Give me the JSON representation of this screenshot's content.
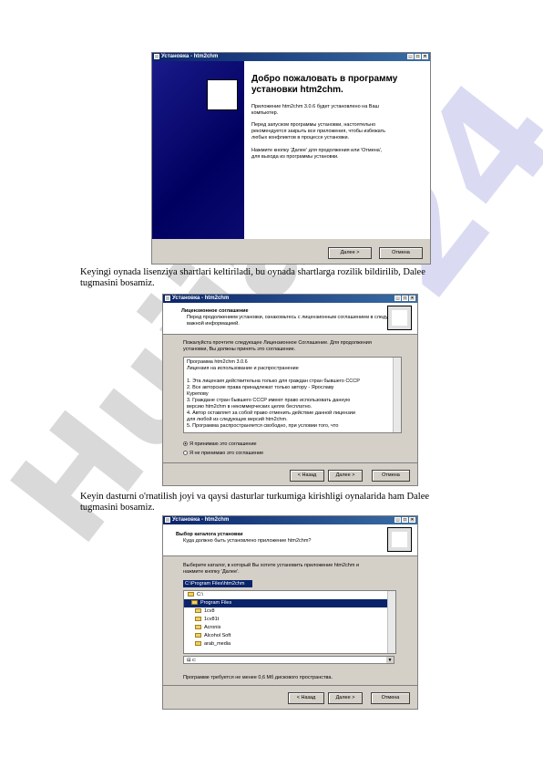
{
  "w1": {
    "title": "Установка - htm2chm",
    "heading1": "Добро пожаловать в программу",
    "heading2": "установки htm2chm.",
    "p1a": "Приложение htm2chm 3.0.6 будет установлено на Ваш",
    "p1b": "компьютер.",
    "p2a": "Перед запуском программы установки, настоятельно",
    "p2b": "рекомендуется закрыть все приложения, чтобы избежать",
    "p2c": "любых конфликтов в процессе установки.",
    "p3a": "Нажмите кнопку 'Далее' для продолжения или 'Отмена',",
    "p3b": "для выхода из программы установки.",
    "next": "Далее >",
    "cancel": "Отмена"
  },
  "para1": {
    "l1": "Keyingi oynada lisenziya shartlari keltiriladi,  bu oynada shartlarga rozilik bildirilib,  Dalee",
    "l2": "tugmasini bosamiz."
  },
  "w2": {
    "title": "Установка - htm2chm",
    "hdr_title": "Лицензионное соглашение",
    "hdr_sub1": "Перед продолжением установки, ознакомьтесь с лицензионным соглашением в следующей",
    "hdr_sub2": "важной информацией.",
    "intro1": "Пожалуйста прочтите следующее Лицензионное Соглашение. Для продолжения",
    "intro2": "установки, Вы должны принять это соглашение.",
    "license": [
      "Программа htm2chm 3.0.6",
      "Лицензия на использование и распространение",
      "",
      "1. Эта лицензия действительна только для граждан стран бывшего СССР",
      "2. Все авторские права принадлежат только автору - Ярославу",
      "Курепову",
      "3. Граждане стран бывшего СССР имеют право использовать данную",
      "версию htm2chm в некоммерческих целях бесплатно.",
      "4. Автор оставляет за собой право отменить действие данной лицензии",
      "для любой из следующих версий htm2chm.",
      "5. Программа распространяется свободно, при условии того, что"
    ],
    "accept": "Я принимаю это соглашение",
    "decline": "Я не принимаю это соглашение",
    "back": "< Назад",
    "next": "Далее >",
    "cancel": "Отмена"
  },
  "para2": {
    "l1": "Keyin  dasturni  o'rnatilish  joyi  va  qaysi  dasturlar  turkumiga  kirishligi  oynalarida  ham  Dalee",
    "l2": "tugmasini bosamiz."
  },
  "w3": {
    "title": "Установка - htm2chm",
    "hdr_title": "Выбор каталога установки",
    "hdr_sub": "Куда должно быть установлено приложение htm2chm?",
    "prompt1": "Выберите каталог, в который Вы хотите установить приложение htm2chm и",
    "prompt2": "нажмите кнопку 'Далее'.",
    "path": "C:\\Program Files\\htm2chm",
    "folders": [
      "C:\\",
      "Program Files",
      "1cv8",
      "1cv81t",
      "Acronis",
      "Alcohol Soft",
      "arab_media"
    ],
    "drive": "c:",
    "space": "Программе требуется не менее 0,6 Мб дискового пространства.",
    "back": "< Назад",
    "next": "Далее >",
    "cancel": "Отмена"
  },
  "watermark": {
    "text1": "Hujjat",
    "text2": "24"
  }
}
